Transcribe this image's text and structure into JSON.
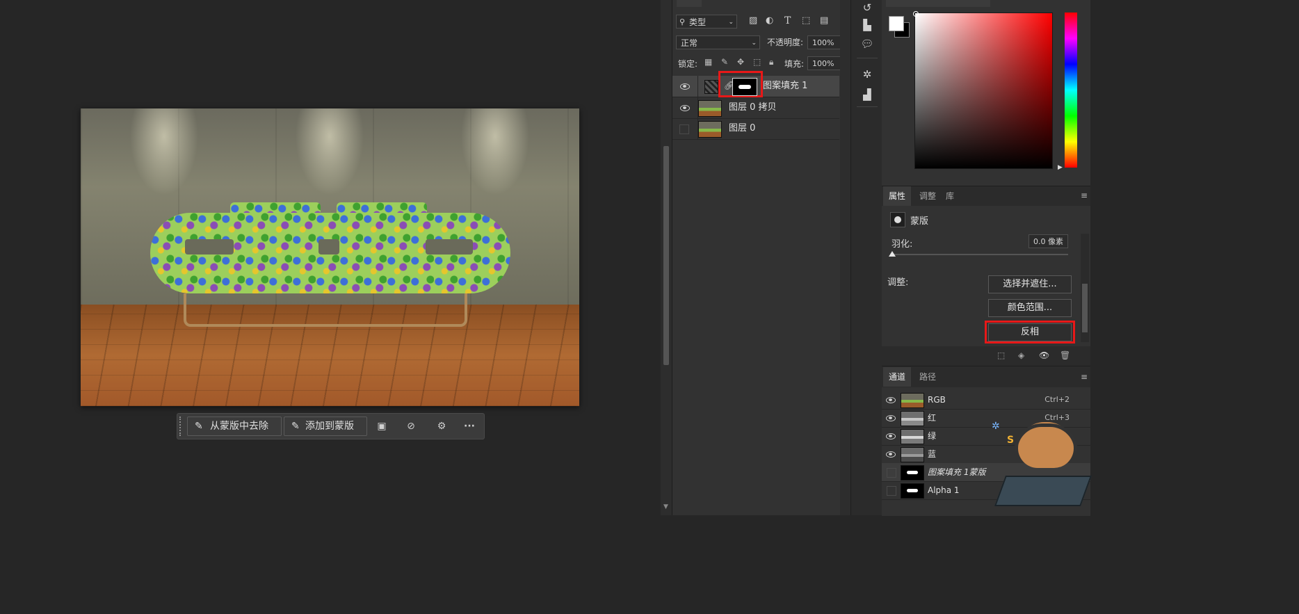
{
  "mask_toolbar": {
    "remove_from_mask": "从蒙版中去除",
    "add_to_mask": "添加到蒙版",
    "more": "···"
  },
  "layers": {
    "filter_kind": "类型",
    "blend_mode": "正常",
    "opacity_label": "不透明度:",
    "opacity_value": "100%",
    "lock_label": "锁定:",
    "fill_label": "填充:",
    "fill_value": "100%",
    "items": [
      {
        "name": "图案填充 1",
        "visible": true,
        "selected": true
      },
      {
        "name": "图层 0 拷贝",
        "visible": true,
        "selected": false
      },
      {
        "name": "图层 0",
        "visible": false,
        "selected": false
      }
    ]
  },
  "properties": {
    "tabs": [
      "属性",
      "调整",
      "库"
    ],
    "type_label": "蒙版",
    "feather_label": "羽化:",
    "feather_value": "0.0 像素",
    "adjust_label": "调整:",
    "select_and_mask": "选择并遮住...",
    "color_range": "颜色范围...",
    "invert": "反相"
  },
  "channels": {
    "tabs": [
      "通道",
      "路径"
    ],
    "items": [
      {
        "name": "RGB",
        "shortcut": "Ctrl+2",
        "visible": true
      },
      {
        "name": "红",
        "shortcut": "Ctrl+3",
        "visible": true
      },
      {
        "name": "绿",
        "shortcut": "",
        "visible": true
      },
      {
        "name": "蓝",
        "shortcut": "",
        "visible": true
      },
      {
        "name": "图案填充 1蒙版",
        "shortcut": "",
        "visible": false
      },
      {
        "name": "Alpha 1",
        "shortcut": "",
        "visible": false
      }
    ]
  },
  "colors": {
    "highlight_red": "#e81818",
    "panel_bg": "#323232",
    "canvas_bg": "#262626"
  },
  "icons": {
    "search": "search-icon",
    "eye": "eye-icon",
    "lock": "lock-icon",
    "link": "chain-link-icon"
  }
}
